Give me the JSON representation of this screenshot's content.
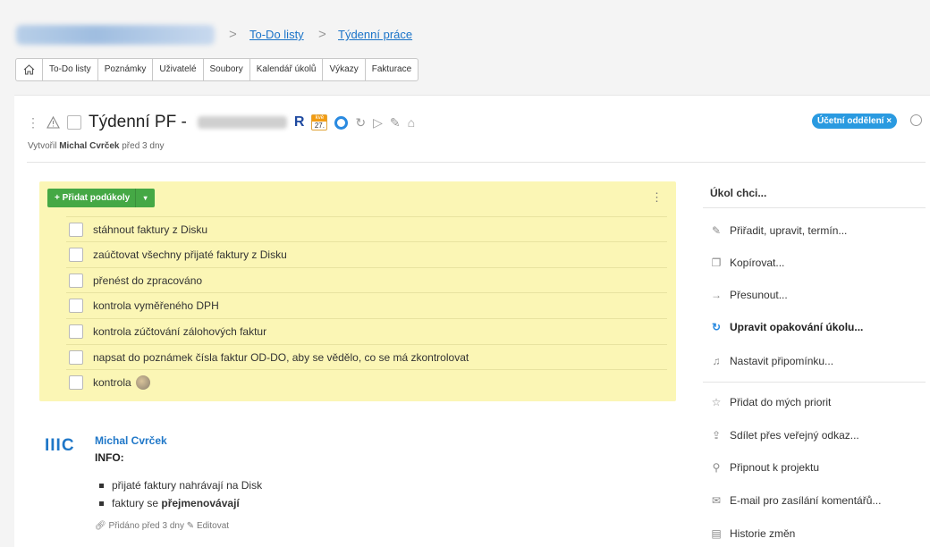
{
  "breadcrumb": {
    "sep1": ">",
    "link1": "To-Do listy",
    "sep2": ">",
    "link2": "Týdenní práce"
  },
  "tabs": [
    "To-Do listy",
    "Poznámky",
    "Uživatelé",
    "Soubory",
    "Kalendář úkolů",
    "Výkazy",
    "Fakturace"
  ],
  "task": {
    "title": "Týdenní PF -",
    "r_badge": "R",
    "cal_month": "kvě",
    "cal_day": "27.",
    "department": "Účetní oddělení ×",
    "created_prefix": "Vytvořil",
    "created_by": "Michal Cvrček",
    "created_suffix": "před 3 dny"
  },
  "subtasks": {
    "add_label": "+ Přidat podúkoly",
    "items": [
      "stáhnout faktury z Disku",
      "zaúčtovat všechny přijaté faktury z Disku",
      "přenést do zpracováno",
      "kontrola vyměřeného DPH",
      "kontrola zúčtování zálohových faktur",
      "napsat do poznámek čísla faktur OD-DO, aby se vědělo, co se má zkontrolovat",
      "kontrola"
    ]
  },
  "comment": {
    "logo": "IIIC",
    "author": "Michal Cvrček",
    "heading": "INFO:",
    "bullet1": "přijaté faktury nahrávají na Disk",
    "bullet2_prefix": "faktury se",
    "bullet2_bold": "přejmenovávají",
    "meta_added": "Přidáno před 3 dny",
    "meta_edit": "Editovat"
  },
  "actions": {
    "title": "Úkol chci...",
    "items": [
      {
        "label": "Přiřadit, upravit, termín...",
        "icon": "pencil-icon"
      },
      {
        "label": "Kopírovat...",
        "icon": "copy-icon"
      },
      {
        "label": "Přesunout...",
        "icon": "arrow-right-icon"
      },
      {
        "label": "Upravit opakování úkolu...",
        "icon": "repeat-icon"
      },
      {
        "label": "Nastavit připomínku...",
        "icon": "bell-icon"
      },
      {
        "label": "Přidat do mých priorit",
        "icon": "star-icon"
      },
      {
        "label": "Sdílet přes veřejný odkaz...",
        "icon": "share-icon"
      },
      {
        "label": "Připnout k projektu",
        "icon": "pin-icon"
      },
      {
        "label": "E-mail pro zasílání komentářů...",
        "icon": "mail-icon"
      },
      {
        "label": "Historie změn",
        "icon": "history-icon"
      }
    ]
  },
  "colors": {
    "accent": "#2a8ae0",
    "add_button": "#45a845",
    "subtasks_bg": "#fbf6b5",
    "link": "#1a73c8"
  }
}
